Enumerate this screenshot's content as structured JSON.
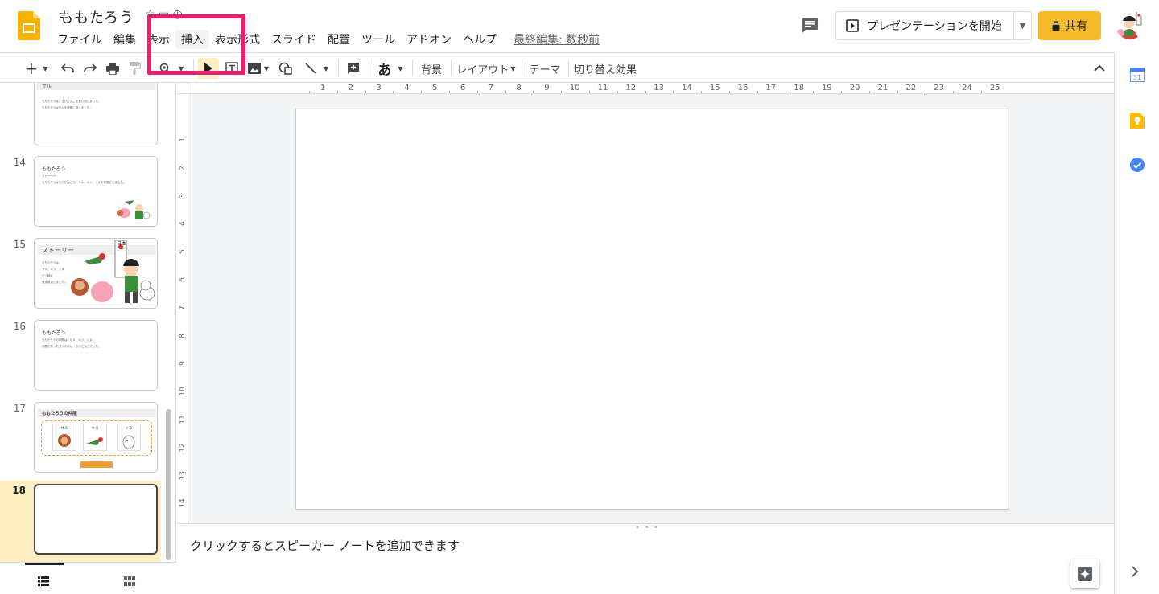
{
  "document": {
    "title": "ももたろう"
  },
  "menu": {
    "items": [
      "ファイル",
      "編集",
      "表示",
      "挿入",
      "表示",
      "形式",
      "スライド",
      "配置",
      "ツール",
      "アドオン",
      "ヘルプ"
    ],
    "last_edit": "最終編集: 数秒前"
  },
  "header": {
    "present_label": "プレゼンテーションを開始",
    "share_label": "共有"
  },
  "toolbar": {
    "background_label": "背景",
    "layout_label": "レイアウト",
    "theme_label": "テーマ",
    "transition_label": "切り替え効果",
    "text_glyph": "あ"
  },
  "ruler": {
    "horizontal": [
      "1",
      "2",
      "3",
      "4",
      "5",
      "6",
      "7",
      "8",
      "9",
      "10",
      "11",
      "12",
      "13",
      "14",
      "15",
      "16",
      "17",
      "18",
      "19",
      "20",
      "21",
      "22",
      "23",
      "24",
      "25"
    ],
    "vertical": [
      "1",
      "2",
      "3",
      "4",
      "5",
      "6",
      "7",
      "8",
      "9",
      "10",
      "11",
      "12",
      "13",
      "14"
    ]
  },
  "filmstrip": {
    "slides": [
      {
        "number": "",
        "title": "サル",
        "lines": [
          "ももたろうは、きびだんごを差し出しました。",
          "ももたろうはサルを仲間に迎えました。"
        ]
      },
      {
        "number": "14",
        "title": "ももたろう",
        "lines": [
          "ストーリー",
          "ももたろうはきびだんごで、サル、キジ、イヌを仲間にしました。"
        ]
      },
      {
        "number": "15",
        "title": "ストーリー",
        "lines": [
          "ももたろうは、",
          "サル、キジ、イヌ",
          "と一緒に",
          "鬼を退治しました。"
        ],
        "flag": "日本一"
      },
      {
        "number": "16",
        "title": "ももたろう",
        "lines": [
          "ももたろうの仲間は、サル、キジ、イヌ。",
          "仲間になったきっかけは、きびだんごでした。"
        ]
      },
      {
        "number": "17",
        "title": "ももたろうの仲間",
        "cards": [
          "サル",
          "キジ",
          "イヌ"
        ]
      },
      {
        "number": "18",
        "title": ""
      }
    ]
  },
  "notes": {
    "placeholder": "クリックするとスピーカー ノートを追加できます"
  },
  "colors": {
    "highlight": "#ec1f6f",
    "share": "#f6bb2b",
    "slides_logo": "#f4b400",
    "selected_slide": "#feefc3"
  }
}
